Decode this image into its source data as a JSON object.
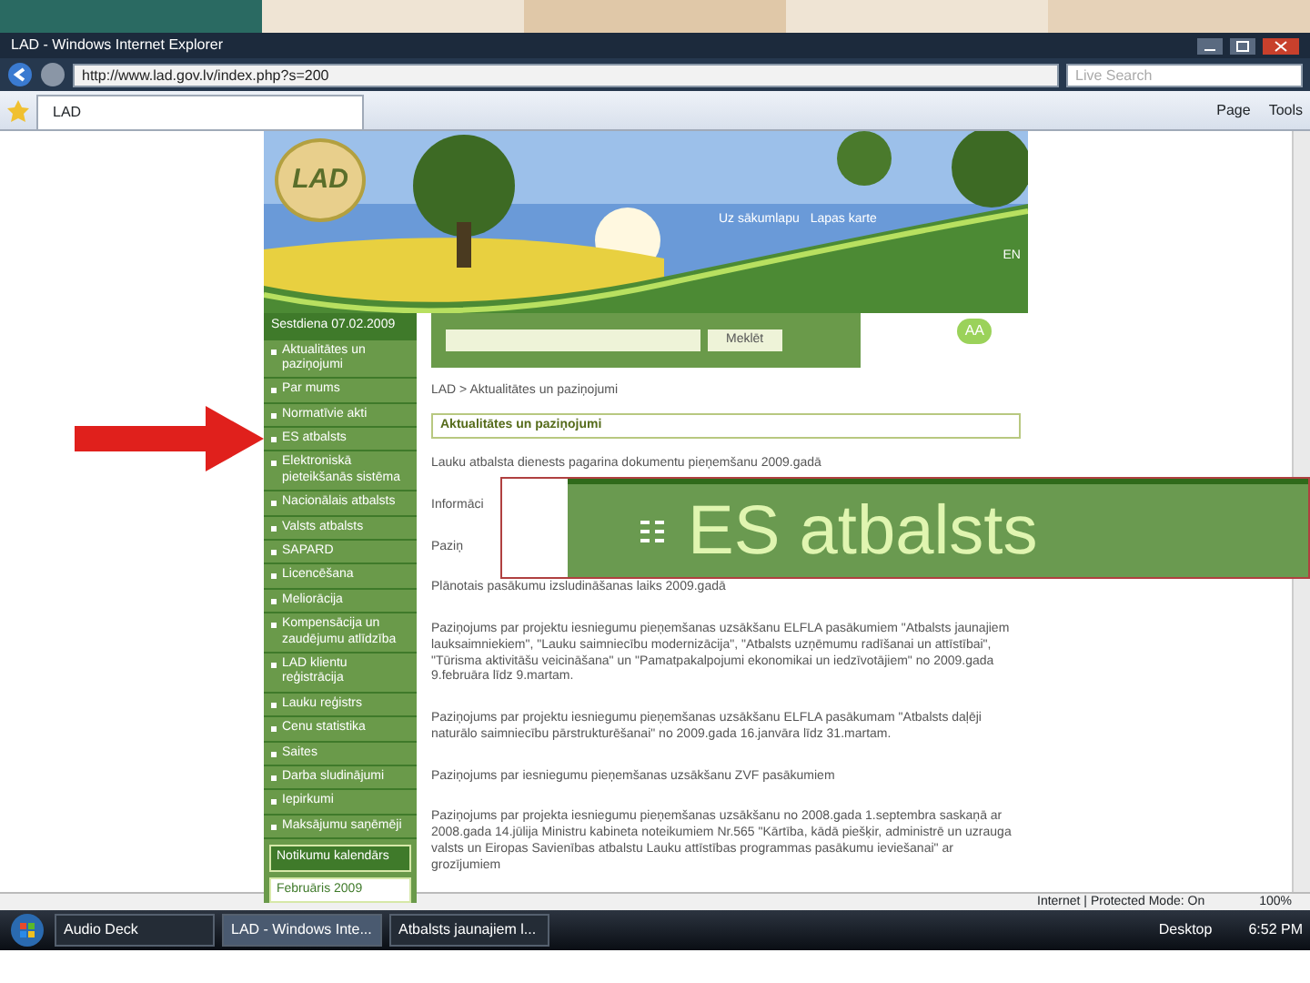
{
  "browser": {
    "title": "LAD - Windows Internet Explorer",
    "url": "http://www.lad.gov.lv/index.php?s=200",
    "search_placeholder": "Live Search",
    "tabs": [
      {
        "label": "LAD",
        "selected": true
      }
    ],
    "toolbar": [
      "Page",
      "Tools"
    ]
  },
  "site": {
    "logo": "LAD",
    "header_links": [
      "Uz sākumlapu",
      "Lapas karte"
    ],
    "language": "EN",
    "font_size": "AA",
    "date_day": "Sestdiena",
    "date": "07.02.2009",
    "search_button": "Meklēt",
    "breadcrumb": "LAD > Aktualitātes un paziņojumi",
    "section_title": "Aktualitātes un paziņojumi",
    "sidebar": [
      {
        "label": "Aktualitātes un paziņojumi"
      },
      {
        "label": "Par mums"
      },
      {
        "label": "Normatīvie akti"
      },
      {
        "label": "ES atbalsts"
      },
      {
        "label": "Elektroniskā pieteikšanās sistēma"
      },
      {
        "label": "Nacionālais atbalsts"
      },
      {
        "label": "Valsts atbalsts"
      },
      {
        "label": "SAPARD"
      },
      {
        "label": "Licencēšana"
      },
      {
        "label": "Meliorācija"
      },
      {
        "label": "Kompensācija un zaudējumu atlīdzība"
      },
      {
        "label": "LAD klientu reģistrācija"
      },
      {
        "label": "Lauku reģistrs"
      },
      {
        "label": "Cenu statistika"
      },
      {
        "label": "Saites"
      },
      {
        "label": "Darba sludinājumi"
      },
      {
        "label": "Iepirkumi"
      },
      {
        "label": "Maksājumu saņēmēji"
      }
    ],
    "calendar_title": "Notikumu kalendārs",
    "calendar_month": "Februāris 2009",
    "paragraphs": [
      "Lauku atbalsta dienests pagarina dokumentu pieņemšanu 2009.gadā",
      "Informāci",
      "Paziņ",
      "Plānotais pasākumu izsludināšanas laiks 2009.gadā",
      "Paziņojums par projektu iesniegumu pieņemšanas uzsākšanu ELFLA pasākumiem \"Atbalsts jaunajiem lauksaimniekiem\", \"Lauku saimniecību modernizācija\", \"Atbalsts uzņēmumu radīšanai un attīstībai\", \"Tūrisma aktivitāšu veicināšana\" un \"Pamatpakalpojumi ekonomikai un iedzīvotājiem\" no 2009.gada 9.februāra līdz 9.martam.",
      "Paziņojums par projektu iesniegumu pieņemšanas uzsākšanu ELFLA pasākumam \"Atbalsts daļēji naturālo saimniecību pārstrukturēšanai\" no 2009.gada 16.janvāra līdz 31.martam.",
      "Paziņojums par iesniegumu pieņemšanas uzsākšanu ZVF pasākumiem",
      "Paziņojums par projekta iesniegumu pieņemšanas uzsākšanu no 2008.gada 1.septembra saskaņā ar 2008.gada 14.jūlija Ministru kabineta noteikumiem Nr.565 \"Kārtība, kādā piešķir, administrē un uzrauga valsts un Eiropas Savienības atbalstu Lauku attīstības programmas pasākumu ieviešanai\" ar grozījumiem"
    ]
  },
  "callout": {
    "text": "ES atbalsts"
  },
  "status_bar": {
    "zone": "Internet | Protected Mode: On",
    "zoom": "100%"
  },
  "taskbar": {
    "items": [
      {
        "label": "Audio Deck",
        "selected": false
      },
      {
        "label": "LAD - Windows Inte...",
        "selected": true
      },
      {
        "label": "Atbalsts jaunajiem l...",
        "selected": false
      }
    ],
    "desktop": "Desktop",
    "clock": "6:52 PM"
  }
}
